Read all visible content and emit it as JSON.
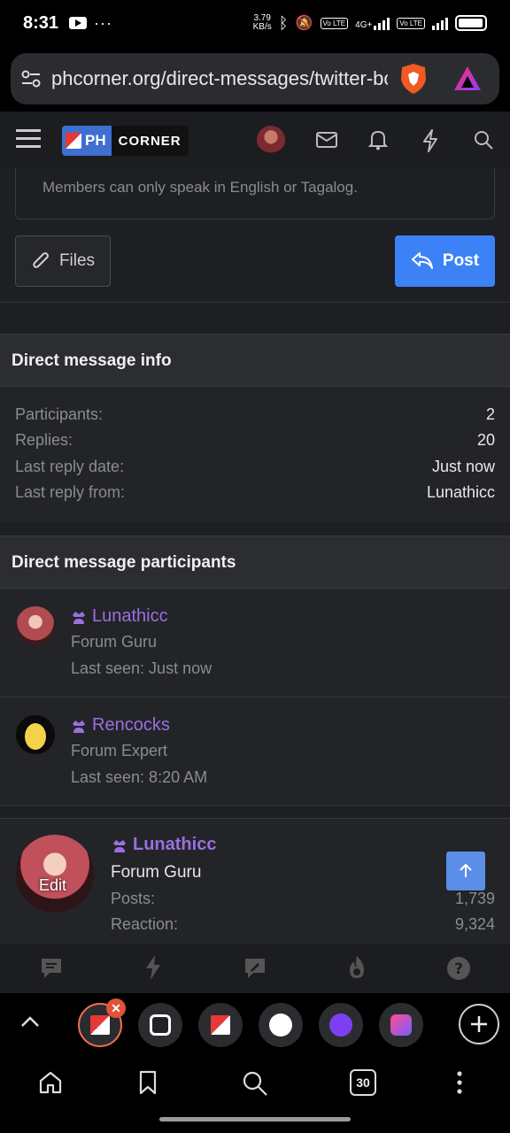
{
  "status_bar": {
    "time": "8:31",
    "net_speed_value": "3.79",
    "net_speed_unit": "KB/s",
    "network": "4G+",
    "volte_1": "Vo LTE",
    "volte_2": "Vo LTE"
  },
  "browser": {
    "url": "phcorner.org/direct-messages/twitter-bo",
    "tab_count": "30"
  },
  "site": {
    "logo_ph": "PH",
    "logo_corner": "CORNER"
  },
  "composer": {
    "placeholder": "Members can only speak in English or Tagalog.",
    "files_label": "Files",
    "post_label": "Post"
  },
  "dm_info": {
    "heading": "Direct message info",
    "rows": [
      {
        "label": "Participants:",
        "value": "2"
      },
      {
        "label": "Replies:",
        "value": "20"
      },
      {
        "label": "Last reply date:",
        "value": "Just now"
      },
      {
        "label": "Last reply from:",
        "value": "Lunathicc"
      }
    ]
  },
  "participants": {
    "heading": "Direct message participants",
    "members": [
      {
        "name": "Lunathicc",
        "title": "Forum Guru",
        "last_seen": "Last seen: Just now"
      },
      {
        "name": "Rencocks",
        "title": "Forum Expert",
        "last_seen": "Last seen: 8:20 AM"
      }
    ]
  },
  "profile_card": {
    "name": "Lunathicc",
    "title": "Forum Guru",
    "edit_label": "Edit",
    "stats": [
      {
        "label": "Posts:",
        "value": "1,739"
      },
      {
        "label": "Reaction:",
        "value": "9,324"
      }
    ]
  },
  "colors": {
    "accent": "#3c82f6",
    "username": "#9b6fe0",
    "background": "#1e1f22"
  }
}
